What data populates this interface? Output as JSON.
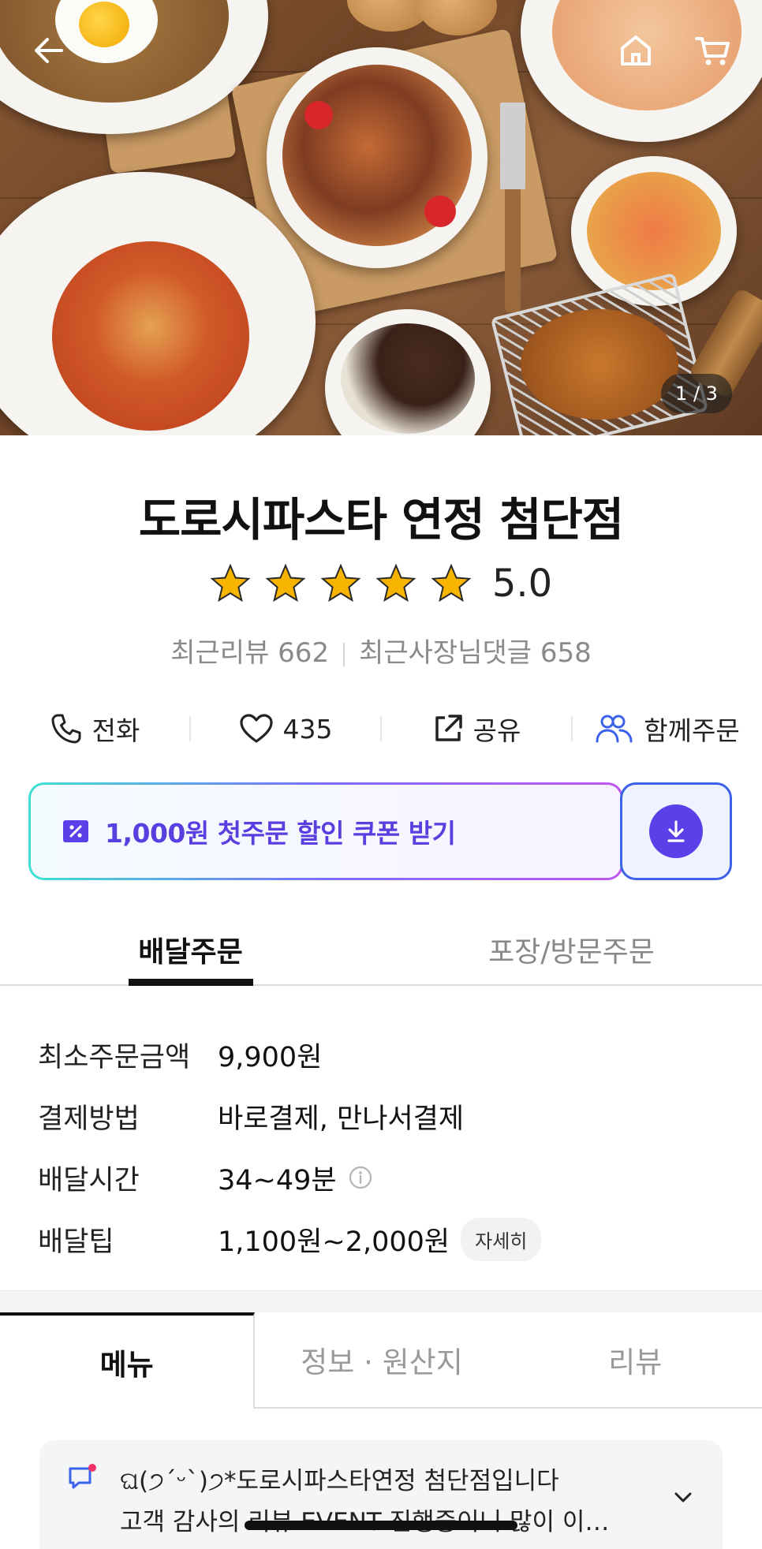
{
  "hero": {
    "counter": "1 / 3",
    "back_icon": "arrow-left-icon",
    "home_icon": "home-icon",
    "cart_icon": "cart-icon"
  },
  "store": {
    "name": "도로시파스타 연정 첨단점",
    "rating": "5.0",
    "stars": 5,
    "recent_reviews_label": "최근리뷰 662",
    "owner_replies_label": "최근사장님댓글 658"
  },
  "actions": {
    "call": "전화",
    "like_count": "435",
    "share": "공유",
    "group_order": "함께주문"
  },
  "coupon": {
    "text": "1,000원 첫주문 할인 쿠폰 받기"
  },
  "order_tabs": [
    {
      "label": "배달주문"
    },
    {
      "label": "포장/방문주문"
    }
  ],
  "info": {
    "min_order": {
      "label": "최소주문금액",
      "value": "9,900원"
    },
    "payment": {
      "label": "결제방법",
      "value": "바로결제, 만나서결제"
    },
    "delivery_time": {
      "label": "배달시간",
      "value": "34~49분"
    },
    "delivery_tip": {
      "label": "배달팁",
      "value": "1,100원~2,000원",
      "detail_button": "자세히"
    }
  },
  "menu_tabs": [
    {
      "label": "메뉴"
    },
    {
      "label": "정보 · 원산지"
    },
    {
      "label": "리뷰"
    }
  ],
  "notice": {
    "line1": "ଘ(੭ˊᵕˋ)੭*도로시파스타연정 첨단점입니다",
    "line2": "고객 감사의 리뷰 EVENT 진행중이니   많이 이…"
  },
  "colors": {
    "accent_purple": "#5b3fe8",
    "coupon_text": "#5a3fe0",
    "group_icon_blue": "#3b62e8",
    "star": "#f7b500"
  }
}
